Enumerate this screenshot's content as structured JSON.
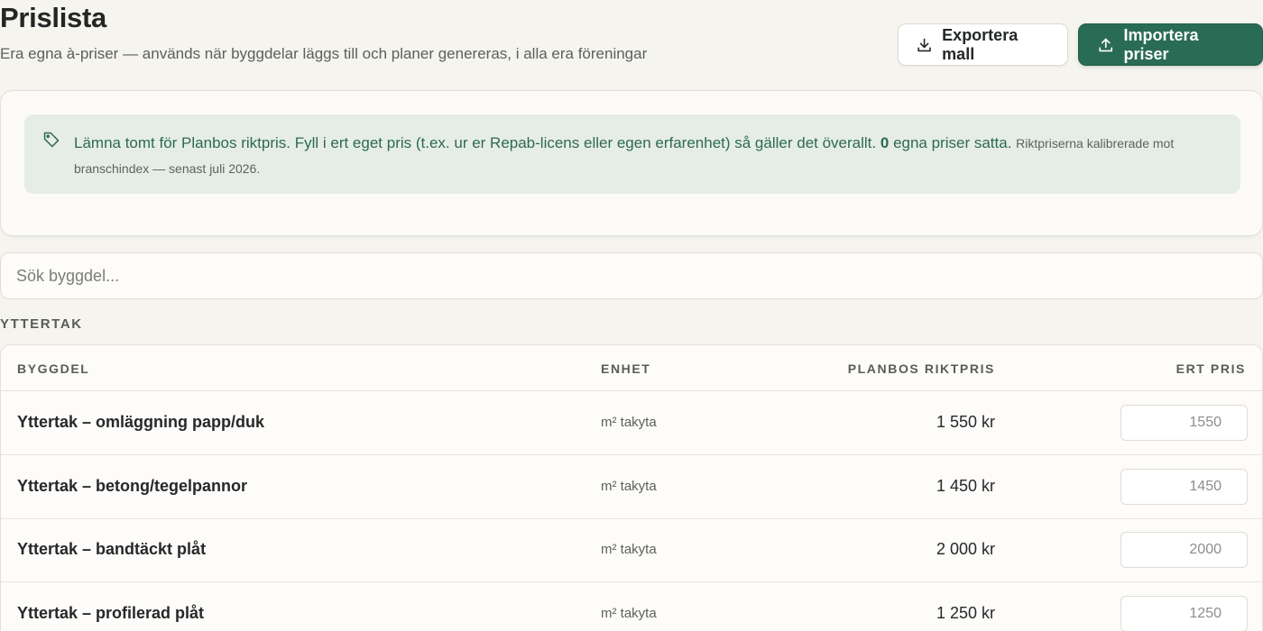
{
  "header": {
    "title": "Prislista",
    "subtitle": "Era egna à-priser — används när byggdelar läggs till och planer genereras, i alla era föreningar",
    "export_label": "Exportera mall",
    "import_label": "Importera priser"
  },
  "notice": {
    "text_main": "Lämna tomt för Planbos riktpris. Fyll i ert eget pris (t.ex. ur er Repab-licens eller egen erfarenhet) så gäller det överallt.",
    "count": "0",
    "count_suffix": "egna priser satta.",
    "note": "Riktpriserna kalibrerade mot branschindex — senast juli 2026."
  },
  "search": {
    "placeholder": "Sök byggdel..."
  },
  "section": {
    "label": "YTTERTAK"
  },
  "table": {
    "columns": {
      "byggdel": "BYGGDEL",
      "enhet": "ENHET",
      "riktpris": "PLANBOS RIKTPRIS",
      "ert_pris": "ERT PRIS"
    },
    "rows": [
      {
        "name": "Yttertak – omläggning papp/duk",
        "unit": "m² takyta",
        "price": "1 550 kr",
        "placeholder": "1550"
      },
      {
        "name": "Yttertak – betong/tegelpannor",
        "unit": "m² takyta",
        "price": "1 450 kr",
        "placeholder": "1450"
      },
      {
        "name": "Yttertak – bandtäckt plåt",
        "unit": "m² takyta",
        "price": "2 000 kr",
        "placeholder": "2000"
      },
      {
        "name": "Yttertak – profilerad plåt",
        "unit": "m² takyta",
        "price": "1 250 kr",
        "placeholder": "1250"
      }
    ]
  },
  "colors": {
    "primary": "#2a6b55",
    "notice_bg": "#e6ede7",
    "notice_text": "#2d6a52",
    "background": "#f5f4ef"
  },
  "icons": {
    "export": "download-icon",
    "import": "upload-icon",
    "notice": "tag-icon"
  }
}
